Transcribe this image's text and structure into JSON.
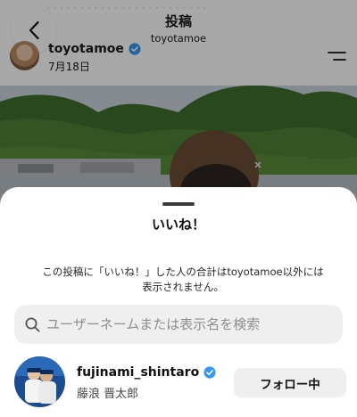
{
  "header": {
    "title": "投稿",
    "subtitle": "toyotamoe",
    "back_icon": "chevron-left-icon",
    "menu_icon": "filter-lines-icon"
  },
  "post": {
    "username": "toyotamoe",
    "verified": true,
    "date": "7月18日"
  },
  "likes_sheet": {
    "title": "いいね！",
    "note": "この投稿に「いいね！」した人の合計はtoyotamoe以外には表示されません。",
    "search": {
      "placeholder": "ユーザーネームまたは表示名を検索",
      "value": ""
    },
    "users": [
      {
        "username": "fujinami_shintaro",
        "display_name": "藤浪 晋太郎",
        "verified": true,
        "follow_label": "フォロー中"
      }
    ]
  },
  "colors": {
    "verified_blue": "#3897f0",
    "button_gray": "#efefef",
    "dim_overlay": "rgba(0,0,0,0.34)"
  }
}
